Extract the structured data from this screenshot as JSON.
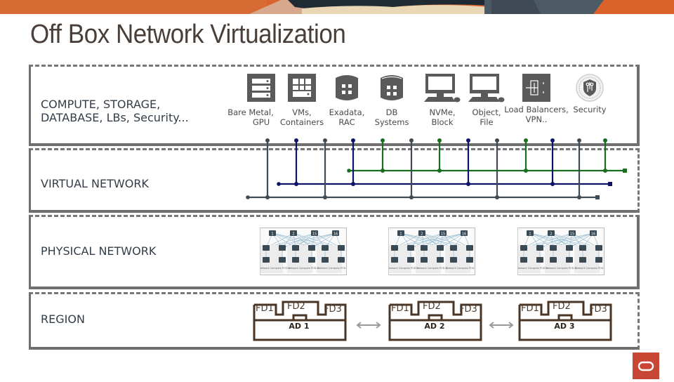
{
  "title": "Off Box Network Virtualization",
  "colors": {
    "title": "#4a3f38",
    "section_border": "#6f6f6f",
    "icon_gray": "#5a5a5a",
    "line_gray": "#3f4c56",
    "line_navy": "#0d1466",
    "line_green": "#1a6e1f",
    "ad_brown": "#4a3424",
    "oracle_red": "#c74634"
  },
  "sections": [
    {
      "label_line1": "COMPUTE, STORAGE,",
      "label_line2": "DATABASE, LBs, Security..."
    },
    {
      "label": "VIRTUAL NETWORK"
    },
    {
      "label": "PHYSICAL NETWORK"
    },
    {
      "label": "REGION"
    }
  ],
  "services": [
    {
      "icon": "server-rack-icon",
      "line1": "Bare Metal,",
      "line2": "GPU"
    },
    {
      "icon": "vm-grid-icon",
      "line1": "VMs,",
      "line2": "Containers"
    },
    {
      "icon": "database-cylinder-icon",
      "line1": "Exadata,",
      "line2": "RAC"
    },
    {
      "icon": "database-cylinder-icon",
      "line1": "DB",
      "line2": "Systems"
    },
    {
      "icon": "desktop-computer-icon",
      "line1": "NVMe,",
      "line2": "Block"
    },
    {
      "icon": "desktop-computer-icon",
      "line1": "Object,",
      "line2": "File"
    },
    {
      "icon": "load-balancer-icon",
      "line1": "Load Balancers,",
      "line2": "VPN.."
    },
    {
      "icon": "security-shield-icon",
      "line1": "Security",
      "line2": ""
    }
  ],
  "virtual_network": {
    "networks": [
      {
        "name": "gray",
        "color": "#3f4c56"
      },
      {
        "name": "navy",
        "color": "#0d1466"
      },
      {
        "name": "green",
        "color": "#1a6e1f"
      }
    ],
    "drops": [
      "gray",
      "navy",
      "gray",
      "navy",
      "green",
      "gray",
      "green",
      "navy",
      "gray",
      "green",
      "navy",
      "gray",
      "green"
    ]
  },
  "physical_network": {
    "thumbnails": [
      {
        "spine_nodes": [
          "1",
          "2",
          "15",
          "16"
        ],
        "pods": [
          "Network Compute POD A",
          "Network Compute POD B",
          "Network Compute POD C"
        ]
      },
      {
        "spine_nodes": [
          "1",
          "2",
          "15",
          "16"
        ],
        "pods": [
          "Network Compute POD A",
          "Network Compute POD B",
          "Network Compute POD C"
        ]
      },
      {
        "spine_nodes": [
          "1",
          "2",
          "15",
          "16"
        ],
        "pods": [
          "Network Compute POD A",
          "Network Compute POD B",
          "Network Compute POD C"
        ]
      }
    ]
  },
  "region": {
    "availability_domains": [
      {
        "label": "AD 1",
        "fault_domains": [
          "FD1",
          "FD2",
          "FD3"
        ]
      },
      {
        "label": "AD 2",
        "fault_domains": [
          "FD1",
          "FD2",
          "FD3"
        ]
      },
      {
        "label": "AD 3",
        "fault_domains": [
          "FD1",
          "FD2",
          "FD3"
        ]
      }
    ]
  },
  "logo": {
    "icon": "oracle-logo-icon"
  }
}
